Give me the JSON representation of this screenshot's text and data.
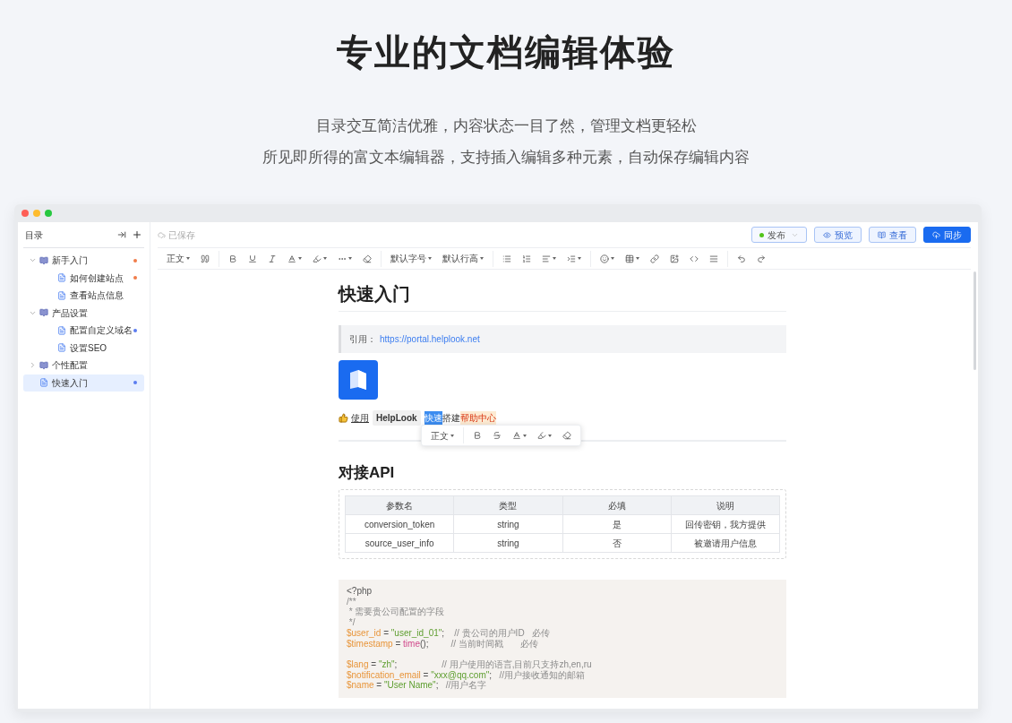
{
  "hero": {
    "title": "专业的文档编辑体验",
    "subtitles": [
      "目录交互简洁优雅，内容状态一目了然，管理文档更轻松",
      "所见即所得的富文本编辑器，支持插入编辑多种元素，自动保存编辑内容"
    ]
  },
  "sidebar": {
    "title": "目录",
    "items": [
      {
        "label": "新手入门",
        "kind": "folder",
        "expanded": true,
        "selected": false,
        "color": "#f07c4a",
        "children": [
          {
            "label": "如何创建站点",
            "kind": "doc",
            "selected": false,
            "color": "#f07c4a"
          },
          {
            "label": "查看站点信息",
            "kind": "doc",
            "selected": false
          }
        ]
      },
      {
        "label": "产品设置",
        "kind": "folder",
        "expanded": true,
        "selected": false,
        "children": [
          {
            "label": "配置自定义域名",
            "kind": "doc",
            "selected": false,
            "color": "#5b7cf0"
          },
          {
            "label": "设置SEO",
            "kind": "doc",
            "selected": false
          }
        ]
      },
      {
        "label": "个性配置",
        "kind": "folder",
        "expanded": false,
        "selected": false
      },
      {
        "label": "快速入门",
        "kind": "doc",
        "selected": true,
        "color": "#5b7cf0"
      }
    ]
  },
  "topbar": {
    "save_status": "已保存",
    "publish": {
      "label": "发布",
      "color": "#52c41a"
    },
    "buttons": [
      {
        "label": "预览",
        "kind": "preview"
      },
      {
        "label": "查看",
        "kind": "view"
      },
      {
        "label": "同步",
        "kind": "sync"
      }
    ]
  },
  "toolbar": {
    "groups": [
      [
        {
          "kind": "text",
          "label": "正文",
          "dropdown": true
        },
        {
          "kind": "quote"
        }
      ],
      [
        {
          "kind": "bold"
        },
        {
          "kind": "underline"
        },
        {
          "kind": "italic"
        },
        {
          "kind": "font-color",
          "dropdown": true
        },
        {
          "kind": "bg-color",
          "dropdown": true
        },
        {
          "kind": "more",
          "dropdown": true
        },
        {
          "kind": "clear"
        }
      ],
      [
        {
          "kind": "text",
          "label": "默认字号",
          "dropdown": true
        },
        {
          "kind": "text",
          "label": "默认行高",
          "dropdown": true
        }
      ],
      [
        {
          "kind": "bullet-list"
        },
        {
          "kind": "ordered-list"
        },
        {
          "kind": "align",
          "dropdown": true
        },
        {
          "kind": "indent",
          "dropdown": true
        }
      ],
      [
        {
          "kind": "emoji",
          "dropdown": true
        },
        {
          "kind": "table",
          "dropdown": true
        },
        {
          "kind": "link"
        },
        {
          "kind": "image"
        },
        {
          "kind": "code"
        },
        {
          "kind": "rule"
        }
      ],
      [
        {
          "kind": "undo"
        },
        {
          "kind": "redo"
        }
      ]
    ]
  },
  "document": {
    "title": "快速入门",
    "quote": {
      "label": "引用：",
      "link": "https://portal.helplook.net"
    },
    "paragraph": [
      {
        "kind": "underline",
        "text": "使用"
      },
      {
        "kind": "code",
        "text": "HelpLook"
      },
      {
        "kind": "selected",
        "text": "快速"
      },
      {
        "kind": "plain",
        "text": "搭建"
      },
      {
        "kind": "highlight",
        "text": "帮助中心"
      }
    ],
    "float_toolbar": {
      "groups": [
        [
          {
            "kind": "text",
            "label": "正文",
            "dropdown": true
          }
        ],
        [
          {
            "kind": "bold"
          },
          {
            "kind": "strike"
          },
          {
            "kind": "font-color",
            "dropdown": true
          },
          {
            "kind": "bg-color",
            "dropdown": true
          },
          {
            "kind": "clear"
          }
        ]
      ]
    },
    "heading": "对接API",
    "table": {
      "columns": [
        "参数名",
        "类型",
        "必填",
        "说明"
      ],
      "rows": [
        [
          "conversion_token",
          "string",
          "是",
          "回传密钥，我方提供"
        ],
        [
          "source_user_info",
          "string",
          "否",
          "被邀请用户信息"
        ]
      ]
    },
    "code": [
      {
        "segments": [
          {
            "kind": "plain",
            "text": "<?php"
          }
        ]
      },
      {
        "segments": [
          {
            "kind": "comment",
            "text": "/**"
          }
        ]
      },
      {
        "segments": [
          {
            "kind": "comment",
            "text": " * 需要贵公司配置的字段"
          }
        ]
      },
      {
        "segments": [
          {
            "kind": "comment",
            "text": " */"
          }
        ]
      },
      {
        "segments": [
          {
            "kind": "var",
            "text": "$user_id"
          },
          {
            "kind": "plain",
            "text": " = "
          },
          {
            "kind": "str",
            "text": "\"user_id_01\""
          },
          {
            "kind": "plain",
            "text": ";    "
          },
          {
            "kind": "comment",
            "text": "// 贵公司的用户ID   必传"
          }
        ]
      },
      {
        "segments": [
          {
            "kind": "var",
            "text": "$timestamp"
          },
          {
            "kind": "plain",
            "text": " = "
          },
          {
            "kind": "func",
            "text": "time"
          },
          {
            "kind": "plain",
            "text": "();         "
          },
          {
            "kind": "comment",
            "text": "// 当前时间戳       必传"
          }
        ]
      },
      {
        "gap_before": true,
        "segments": [
          {
            "kind": "var",
            "text": "$lang"
          },
          {
            "kind": "plain",
            "text": " = "
          },
          {
            "kind": "str",
            "text": "\"zh\""
          },
          {
            "kind": "plain",
            "text": ";                  "
          },
          {
            "kind": "comment",
            "text": "// 用户使用的语言,目前只支持zh,en,ru"
          }
        ]
      },
      {
        "segments": [
          {
            "kind": "var",
            "text": "$notification_email"
          },
          {
            "kind": "plain",
            "text": " = "
          },
          {
            "kind": "str",
            "text": "\"xxx@qq.com\""
          },
          {
            "kind": "plain",
            "text": ";   "
          },
          {
            "kind": "comment",
            "text": "//用户接收通知的邮箱"
          }
        ]
      },
      {
        "segments": [
          {
            "kind": "var",
            "text": "$name"
          },
          {
            "kind": "plain",
            "text": " = "
          },
          {
            "kind": "str",
            "text": "\"User Name\""
          },
          {
            "kind": "plain",
            "text": ";   "
          },
          {
            "kind": "comment",
            "text": "//用户名字"
          }
        ]
      }
    ]
  }
}
